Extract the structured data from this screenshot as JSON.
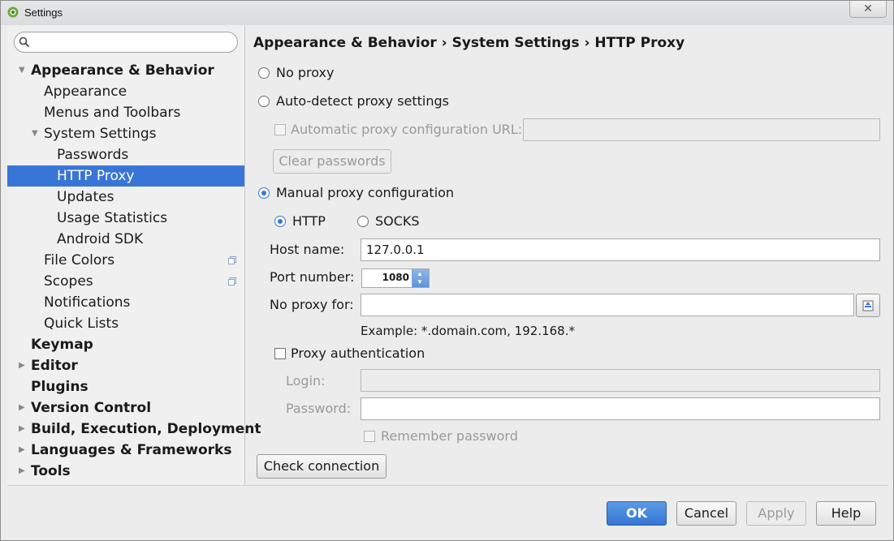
{
  "window": {
    "title": "Settings",
    "close_symbol": "✕"
  },
  "search": {
    "placeholder": "",
    "value": ""
  },
  "sidebar": {
    "items": [
      {
        "label": "Appearance & Behavior",
        "bold": true,
        "arrow": "down",
        "level": 0
      },
      {
        "label": "Appearance",
        "level": 1
      },
      {
        "label": "Menus and Toolbars",
        "level": 1
      },
      {
        "label": "System Settings",
        "arrow": "down",
        "level": 1
      },
      {
        "label": "Passwords",
        "level": 2
      },
      {
        "label": "HTTP Proxy",
        "level": 2,
        "selected": true
      },
      {
        "label": "Updates",
        "level": 2
      },
      {
        "label": "Usage Statistics",
        "level": 2
      },
      {
        "label": "Android SDK",
        "level": 2
      },
      {
        "label": "File Colors",
        "level": 1,
        "project_icon": true
      },
      {
        "label": "Scopes",
        "level": 1,
        "project_icon": true
      },
      {
        "label": "Notifications",
        "level": 1
      },
      {
        "label": "Quick Lists",
        "level": 1
      },
      {
        "label": "Keymap",
        "bold": true,
        "level": 0
      },
      {
        "label": "Editor",
        "bold": true,
        "arrow": "right",
        "level": 0
      },
      {
        "label": "Plugins",
        "bold": true,
        "level": 0
      },
      {
        "label": "Version Control",
        "bold": true,
        "arrow": "right",
        "level": 0
      },
      {
        "label": "Build, Execution, Deployment",
        "bold": true,
        "arrow": "right",
        "level": 0
      },
      {
        "label": "Languages & Frameworks",
        "bold": true,
        "arrow": "right",
        "level": 0
      },
      {
        "label": "Tools",
        "bold": true,
        "arrow": "right",
        "level": 0
      }
    ]
  },
  "main": {
    "breadcrumb": "Appearance & Behavior › System Settings › HTTP Proxy",
    "no_proxy_label": "No proxy",
    "auto_detect_label": "Auto-detect proxy settings",
    "auto_url_label": "Automatic proxy configuration URL:",
    "auto_url_value": "",
    "clear_passwords_label": "Clear passwords",
    "manual_label": "Manual proxy configuration",
    "http_label": "HTTP",
    "socks_label": "SOCKS",
    "host_label": "Host name:",
    "host_value": "127.0.0.1",
    "port_label": "Port number:",
    "port_value": "1080",
    "no_proxy_for_label": "No proxy for:",
    "no_proxy_for_value": "",
    "example_text": "Example: *.domain.com, 192.168.*",
    "proxy_auth_label": "Proxy authentication",
    "login_label": "Login:",
    "login_value": "",
    "password_label": "Password:",
    "password_value": "",
    "remember_label": "Remember password",
    "check_connection_label": "Check connection",
    "selected_proxy_mode": "manual",
    "selected_protocol": "HTTP"
  },
  "footer": {
    "ok_label": "OK",
    "cancel_label": "Cancel",
    "apply_label": "Apply",
    "help_label": "Help"
  },
  "colors": {
    "accent": "#3875d7",
    "selection": "#3875d7"
  }
}
